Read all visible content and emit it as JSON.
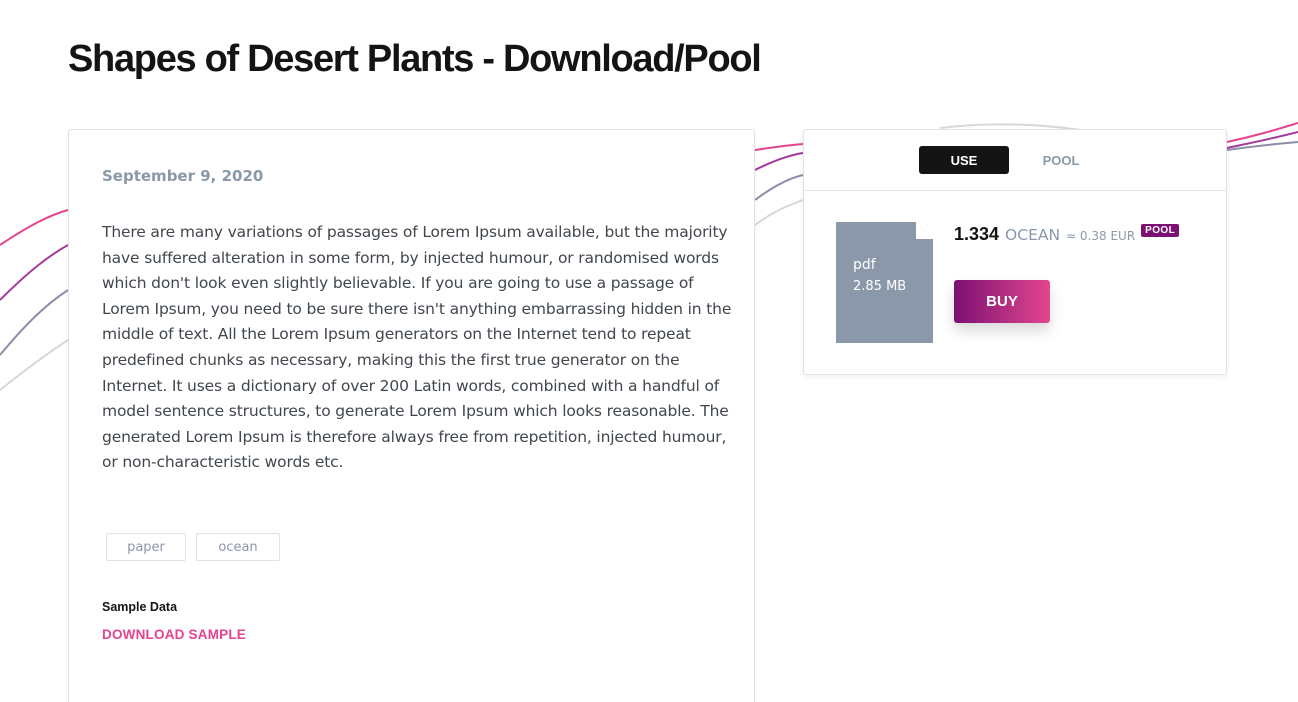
{
  "page": {
    "title": "Shapes of Desert Plants - Download/Pool"
  },
  "asset": {
    "date": "September 9, 2020",
    "description": "There are many variations of passages of Lorem Ipsum available, but the majority have suffered alteration in some form, by injected humour, or randomised words which don't look even slightly believable. If you are going to use a passage of Lorem Ipsum, you need to be sure there isn't anything embarrassing hidden in the middle of text. All the Lorem Ipsum generators on the Internet tend to repeat predefined chunks as necessary, making this the first true generator on the Internet. It uses a dictionary of over 200 Latin words, combined with a handful of model sentence structures, to generate Lorem Ipsum which looks reasonable. The generated Lorem Ipsum is therefore always free from repetition, injected humour, or non-characteristic words etc.",
    "tags": [
      "paper",
      "ocean"
    ],
    "sample_label": "Sample Data",
    "download_sample_label": "DOWNLOAD SAMPLE"
  },
  "sidebar": {
    "tabs": [
      {
        "label": "USE",
        "active": true
      },
      {
        "label": "POOL",
        "active": false
      }
    ],
    "file": {
      "type": "pdf",
      "size": "2.85 MB",
      "icon": "file-icon"
    },
    "price": {
      "value": "1.334",
      "token": "OCEAN",
      "conversion": "≈ 0.38 EUR",
      "badge": "POOL"
    },
    "buy_label": "BUY"
  },
  "colors": {
    "accent_pink": "#e3438f",
    "accent_purple": "#7b1173",
    "muted_text": "#8b98a9",
    "file_icon_gray": "#8b98a9",
    "active_tab_bg": "#141414"
  }
}
